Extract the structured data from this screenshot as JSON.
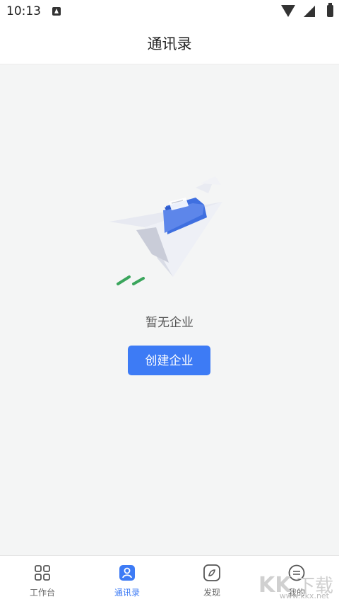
{
  "status_bar": {
    "time": "10:13"
  },
  "header": {
    "title": "通讯录"
  },
  "empty_state": {
    "message": "暂无企业",
    "button_label": "创建企业"
  },
  "tabs": [
    {
      "label": "工作台",
      "icon": "grid-icon",
      "active": false
    },
    {
      "label": "通讯录",
      "icon": "contacts-icon",
      "active": true
    },
    {
      "label": "发现",
      "icon": "compass-icon",
      "active": false
    },
    {
      "label": "我的",
      "icon": "profile-icon",
      "active": false
    }
  ],
  "watermark": {
    "brand": "KK下载",
    "url": "www.kkx.net"
  },
  "colors": {
    "accent": "#3d7bf5",
    "background": "#f4f5f5",
    "inactive": "#666666"
  }
}
